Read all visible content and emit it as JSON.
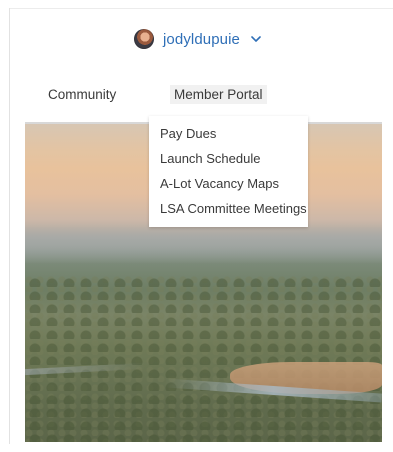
{
  "user": {
    "username": "jodyldupuie",
    "avatar_icon": "avatar-photo",
    "chevron_icon": "chevron-down-icon",
    "link_color": "#2f6fb7"
  },
  "nav": {
    "items": [
      {
        "label": "Community"
      },
      {
        "label": "Member Portal"
      }
    ]
  },
  "dropdown": {
    "items": [
      {
        "label": "Pay Dues"
      },
      {
        "label": "Launch Schedule"
      },
      {
        "label": "A-Lot Vacancy Maps"
      },
      {
        "label": "LSA Committee Meetings"
      }
    ]
  }
}
